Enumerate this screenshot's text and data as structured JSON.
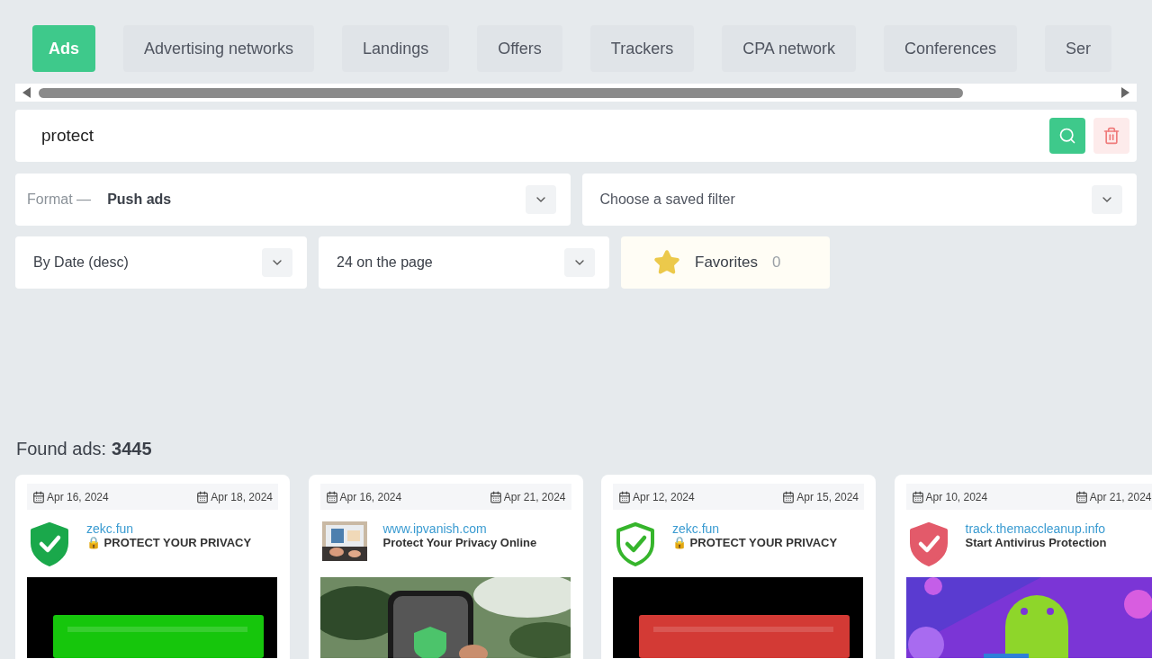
{
  "tabs": [
    {
      "label": "Ads",
      "selected": true
    },
    {
      "label": "Advertising networks",
      "selected": false
    },
    {
      "label": "Landings",
      "selected": false
    },
    {
      "label": "Offers",
      "selected": false
    },
    {
      "label": "Trackers",
      "selected": false
    },
    {
      "label": "CPA network",
      "selected": false
    },
    {
      "label": "Conferences",
      "selected": false
    },
    {
      "label": "Ser",
      "selected": false
    }
  ],
  "search": {
    "value": "protect"
  },
  "format": {
    "label": "Format —",
    "value": "Push ads"
  },
  "saved_filter": {
    "placeholder": "Choose a saved filter"
  },
  "sort": {
    "value": "By Date (desc)"
  },
  "per_page": {
    "value": "24 on the page"
  },
  "favorites": {
    "label": "Favorites",
    "count": "0"
  },
  "found": {
    "label": "Found ads:",
    "count": "3445"
  },
  "ads": [
    {
      "first_seen": "Apr 16, 2024",
      "last_seen": "Apr 18, 2024",
      "domain": "zekc.fun",
      "title": "🔒 PROTECT YOUR PRIVACY",
      "icon": {
        "kind": "shield-filled"
      },
      "creative": {
        "kind": "banner",
        "color": "#16c60c"
      }
    },
    {
      "first_seen": "Apr 16, 2024",
      "last_seen": "Apr 21, 2024",
      "domain": "www.ipvanish.com",
      "title": "Protect Your Privacy Online",
      "creative": {
        "kind": "phone"
      }
    },
    {
      "first_seen": "Apr 12, 2024",
      "last_seen": "Apr 15, 2024",
      "domain": "zekc.fun",
      "title": "🔒 PROTECT YOUR PRIVACY",
      "icon": {
        "kind": "shield-outline"
      },
      "creative": {
        "kind": "banner",
        "color": "#d33a35"
      }
    },
    {
      "first_seen": "Apr 10, 2024",
      "last_seen": "Apr 21, 2024",
      "domain": "track.themaccleanup.info",
      "title": "Start Antivirus Protection",
      "icon": {
        "kind": "shield-red"
      },
      "creative": {
        "kind": "robot"
      }
    }
  ]
}
